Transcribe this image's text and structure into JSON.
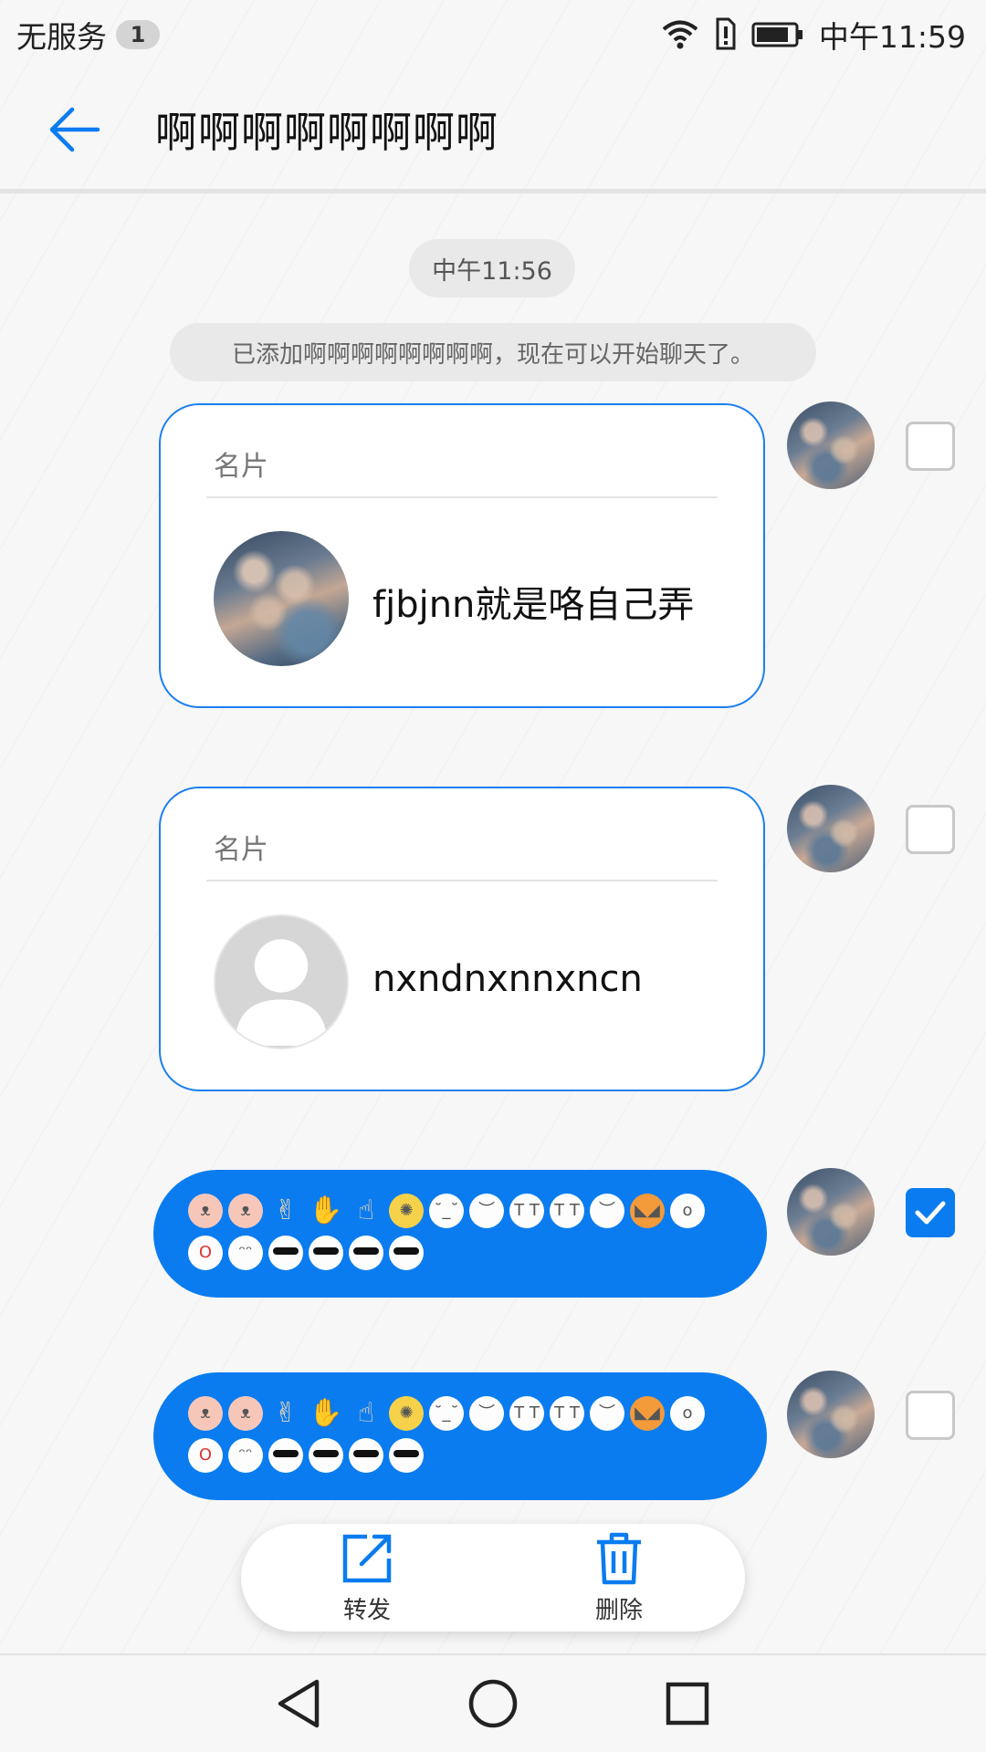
{
  "status_bar": {
    "carrier": "无服务",
    "sim_badge": "1",
    "time": "中午11:59"
  },
  "header": {
    "title": "啊啊啊啊啊啊啊啊"
  },
  "chat": {
    "timestamp": "中午11:56",
    "system_note": "已添加啊啊啊啊啊啊啊啊，现在可以开始聊天了。",
    "messages": [
      {
        "type": "card",
        "label": "名片",
        "name": "fjbjnn就是咯自己弄",
        "avatar": "photo",
        "checked": false
      },
      {
        "type": "card",
        "label": "名片",
        "name": "nxndnxnnxncn",
        "avatar": "default",
        "checked": false
      },
      {
        "type": "emoji",
        "checked": true
      },
      {
        "type": "emoji",
        "checked": false
      }
    ]
  },
  "actions": {
    "forward_label": "转发",
    "delete_label": "删除"
  },
  "colors": {
    "accent": "#0a7cf0",
    "card_border": "#1b7ff0"
  },
  "icons": [
    "back-arrow-icon",
    "wifi-icon",
    "alert-icon",
    "battery-icon",
    "share-icon",
    "trash-icon",
    "nav-back-icon",
    "nav-home-icon",
    "nav-recents-icon"
  ]
}
